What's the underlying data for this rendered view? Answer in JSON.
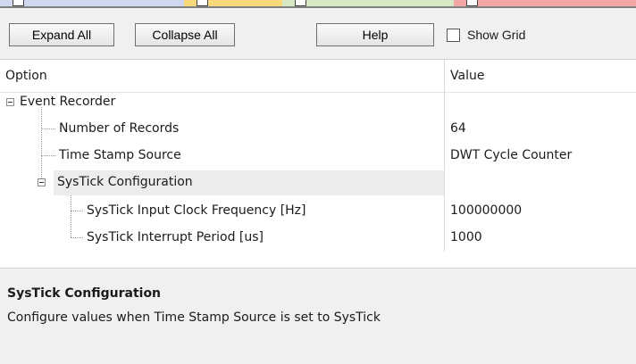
{
  "toolbar": {
    "expand_label": "Expand All",
    "collapse_label": "Collapse All",
    "help_label": "Help",
    "show_grid_label": "Show Grid",
    "show_grid_checked": false
  },
  "grid": {
    "col_option": "Option",
    "col_value": "Value",
    "rows": [
      {
        "label": "Event Recorder",
        "value": "",
        "expanded": true
      },
      {
        "label": "Number of Records",
        "value": "64"
      },
      {
        "label": "Time Stamp Source",
        "value": "DWT Cycle Counter"
      },
      {
        "label": "SysTick Configuration",
        "value": "",
        "expanded": true,
        "selected": true
      },
      {
        "label": "SysTick Input Clock Frequency [Hz]",
        "value": "100000000"
      },
      {
        "label": "SysTick Interrupt Period [us]",
        "value": "1000"
      }
    ]
  },
  "description": {
    "title": "SysTick Configuration",
    "text": "Configure values when Time Stamp Source is set to SysTick"
  },
  "colors": {
    "tab1": "#cfd8ee",
    "tab2": "#f7d87a",
    "tab3": "#d6e8c4",
    "tab4": "#f4a7a7"
  }
}
